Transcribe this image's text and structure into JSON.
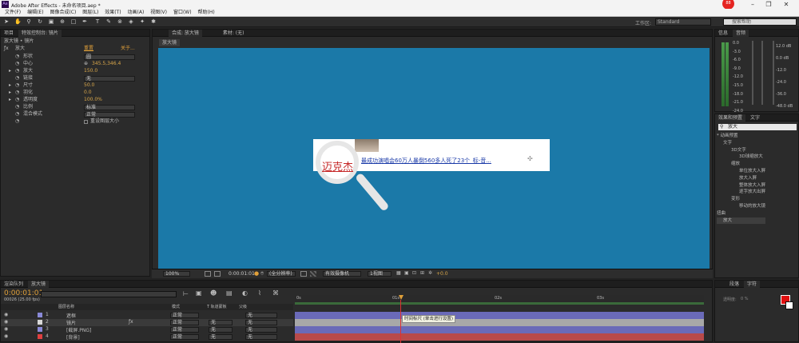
{
  "window": {
    "title": "Adobe After Effects - 未命名项目.aep *",
    "app_icon": "Ae",
    "badge": "88",
    "badge_caption": "点我加速"
  },
  "menu": [
    "文件(F)",
    "编辑(E)",
    "图像合成(C)",
    "图层(L)",
    "效果(T)",
    "动画(A)",
    "视图(V)",
    "窗口(W)",
    "帮助(H)"
  ],
  "toolbar": {
    "workspace_label": "工作区:",
    "workspace_value": "Standard",
    "help_placeholder": "搜索帮助"
  },
  "left_panel": {
    "tabs": [
      "项目",
      "特效控制台: 镜片"
    ],
    "header": "放大镜 • 镜片",
    "effect_name": "放大",
    "reset": "重置",
    "about": "关于...",
    "props": [
      {
        "label": "形状",
        "value": "圆"
      },
      {
        "label": "中心",
        "value": "345.5,346.4"
      },
      {
        "label": "放大",
        "value": "150.0"
      },
      {
        "label": "链接",
        "value": "无"
      },
      {
        "label": "尺寸",
        "value": "50.0"
      },
      {
        "label": "羽化",
        "value": "0.0"
      },
      {
        "label": "透明度",
        "value": "100.0%"
      },
      {
        "label": "比例",
        "value": "标准"
      },
      {
        "label": "混合模式",
        "value": "正常"
      }
    ],
    "checkbox_label": "重设图层大小"
  },
  "comp_panel": {
    "tabs": [
      "合成: 放大镜",
      "素材: (无)"
    ],
    "sub_tab": "放大镜",
    "link_title": "最成功演唱会60万人暴倒560多人死了23个_标-音...",
    "magnified_text": "迈克杰",
    "bottom": {
      "zoom": "100%",
      "time": "0:00:01:01",
      "resolution": "(全分辨率)",
      "camera": "有效摄像机",
      "view": "1视图",
      "exposure": "+0.0"
    }
  },
  "right_panel": {
    "tabs": [
      "信息",
      "音频"
    ],
    "meter_labels": [
      "0.0",
      "-3.0",
      "-6.0",
      "-9.0",
      "-12.0",
      "-15.0",
      "-18.0",
      "-21.0",
      "-24.0"
    ],
    "db_labels": [
      "12.0 dB",
      "0.0 dB",
      "-12.0",
      "-24.0",
      "-36.0",
      "-48.0 dB"
    ],
    "effects": {
      "tabs": [
        "效果和预置",
        "文字"
      ],
      "search": "放大",
      "tree": [
        {
          "label": "* 动画预置",
          "level": 0
        },
        {
          "label": "文字",
          "level": 1
        },
        {
          "label": "3D文字",
          "level": 2
        },
        {
          "label": "3D球缩放大",
          "level": 3
        },
        {
          "label": "缩放",
          "level": 2
        },
        {
          "label": "单位放大入屏",
          "level": 3
        },
        {
          "label": "放大入屏",
          "level": 3
        },
        {
          "label": "整体放大入屏",
          "level": 3
        },
        {
          "label": "逐字放大出屏",
          "level": 3
        },
        {
          "label": "变形",
          "level": 2
        },
        {
          "label": "移动的放大镜",
          "level": 3
        },
        {
          "label": "扭曲",
          "level": 0
        },
        {
          "label": "放大",
          "level": 1
        }
      ]
    },
    "para_tabs": [
      "段落",
      "字符"
    ]
  },
  "timeline": {
    "tabs": [
      "渲染队列",
      "放大镜"
    ],
    "timecode": "0:00:01:01",
    "frame_info": "00026 (25.00 fps)",
    "columns": {
      "layer_name": "图层名称",
      "mode": "模式",
      "trkmat": "T 轨道蒙板",
      "parent": "父级"
    },
    "layers": [
      {
        "num": "1",
        "name": "遮框",
        "mode": "正常",
        "trk": "",
        "parent": "无",
        "color": "#8a8ad8"
      },
      {
        "num": "2",
        "name": "镜片",
        "mode": "正常",
        "trk": "无",
        "parent": "无",
        "color": "#d8d8d8"
      },
      {
        "num": "3",
        "name": "[截屏.PNG]",
        "mode": "正常",
        "trk": "无",
        "parent": "无",
        "color": "#8a8ad8"
      },
      {
        "num": "4",
        "name": "[背景]",
        "mode": "正常",
        "trk": "无",
        "parent": "无",
        "color": "#e04040"
      }
    ],
    "ruler": [
      "0s",
      "01s",
      "02s",
      "03s"
    ],
    "tooltip": "时间标尺 (单击进行设置)"
  },
  "char_panel": {
    "tabs": [
      "段落",
      "字符"
    ],
    "labels": [
      "透明度:",
      "0 %"
    ]
  }
}
